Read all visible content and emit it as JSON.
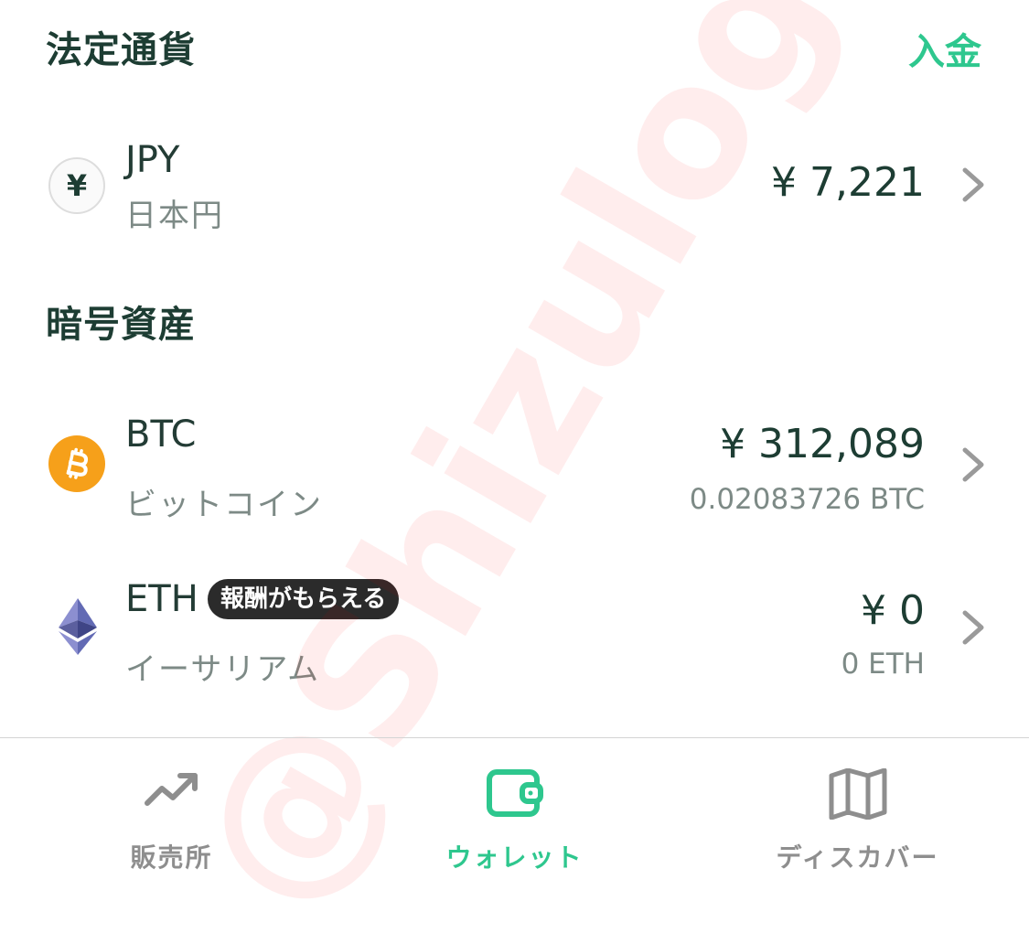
{
  "fiat": {
    "title": "法定通貨",
    "deposit_label": "入金",
    "jpy": {
      "icon": "yen-icon",
      "icon_glyph": "¥",
      "symbol": "JPY",
      "name": "日本円",
      "amount": "¥ 7,221"
    }
  },
  "crypto": {
    "title": "暗号資産",
    "btc": {
      "icon": "bitcoin-icon",
      "symbol": "BTC",
      "name": "ビットコイン",
      "amount": "¥ 312,089",
      "holding": "0.02083726 BTC"
    },
    "eth": {
      "icon": "ethereum-icon",
      "symbol": "ETH",
      "badge": "報酬がもらえる",
      "name": "イーサリアム",
      "amount": "¥ 0",
      "holding": "0 ETH"
    }
  },
  "watermark": "@Shizulog",
  "nav": {
    "items": [
      {
        "label": "販売所",
        "icon": "trending-up-icon",
        "active": false
      },
      {
        "label": "ウォレット",
        "icon": "wallet-icon",
        "active": true
      },
      {
        "label": "ディスカバー",
        "icon": "map-icon",
        "active": false
      }
    ],
    "active_color": "#2ec78e",
    "inactive_color": "#8e8e8e"
  },
  "colors": {
    "accent": "#2ec78e",
    "primary_text": "#1d3d33",
    "secondary_text": "#7d8a86",
    "btc": "#f6a01a",
    "badge_bg": "#2b2b2b"
  }
}
